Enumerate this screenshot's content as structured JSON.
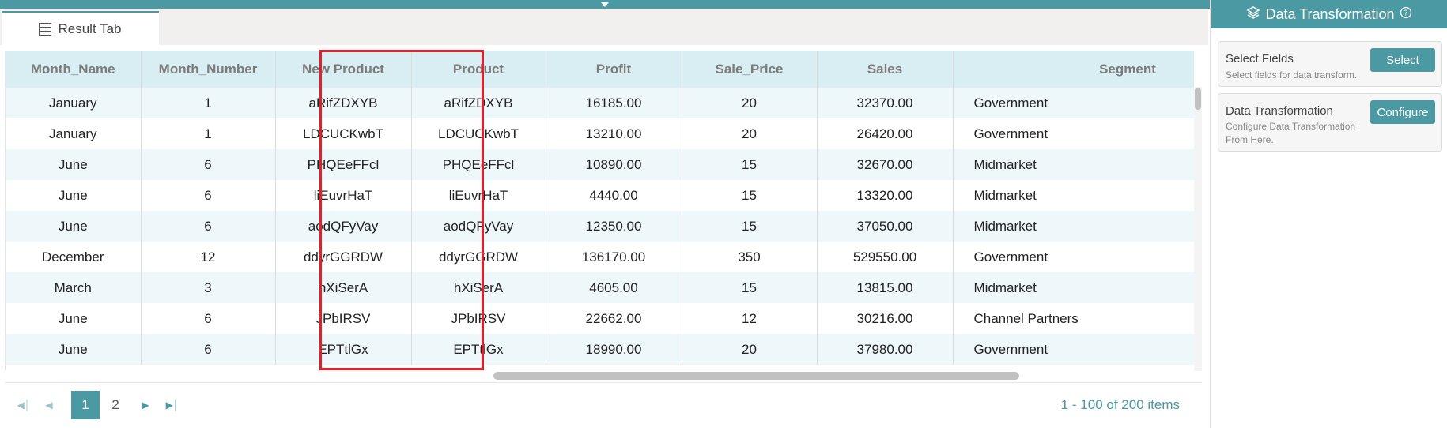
{
  "result_tab": {
    "label": "Result Tab",
    "icon": "table-icon"
  },
  "grid": {
    "columns": [
      "Month_Name",
      "Month_Number",
      "New Product",
      "Product",
      "Profit",
      "Sale_Price",
      "Sales",
      "Segment"
    ],
    "rows": [
      [
        "January",
        "1",
        "aRifZDXYB",
        "aRifZDXYB",
        "16185.00",
        "20",
        "32370.00",
        "Government"
      ],
      [
        "January",
        "1",
        "LDCUCKwbT",
        "LDCUCKwbT",
        "13210.00",
        "20",
        "26420.00",
        "Government"
      ],
      [
        "June",
        "6",
        "PHQEeFFcl",
        "PHQEeFFcl",
        "10890.00",
        "15",
        "32670.00",
        "Midmarket"
      ],
      [
        "June",
        "6",
        "liEuvrHaT",
        "liEuvrHaT",
        "4440.00",
        "15",
        "13320.00",
        "Midmarket"
      ],
      [
        "June",
        "6",
        "aodQFyVay",
        "aodQFyVay",
        "12350.00",
        "15",
        "37050.00",
        "Midmarket"
      ],
      [
        "December",
        "12",
        "ddyrGGRDW",
        "ddyrGGRDW",
        "136170.00",
        "350",
        "529550.00",
        "Government"
      ],
      [
        "March",
        "3",
        "hXiSerA",
        "hXiSerA",
        "4605.00",
        "15",
        "13815.00",
        "Midmarket"
      ],
      [
        "June",
        "6",
        "JPbIRSV",
        "JPbIRSV",
        "22662.00",
        "12",
        "30216.00",
        "Channel Partners"
      ],
      [
        "June",
        "6",
        "EPTtlGx",
        "EPTtlGx",
        "18990.00",
        "20",
        "37980.00",
        "Government"
      ]
    ]
  },
  "pager": {
    "pages": [
      "1",
      "2"
    ],
    "current": "1",
    "info": "1 - 100 of 200 items"
  },
  "panel": {
    "title": "Data Transformation",
    "select_fields": {
      "title": "Select Fields",
      "subtitle": "Select fields for data transform.",
      "button": "Select"
    },
    "data_transformation": {
      "title": "Data Transformation",
      "subtitle": "Configure Data Transformation From Here.",
      "button": "Configure"
    }
  },
  "colors": {
    "accent": "#4b9aa3",
    "highlight": "#e32027",
    "header_bg": "#d9eef3"
  }
}
